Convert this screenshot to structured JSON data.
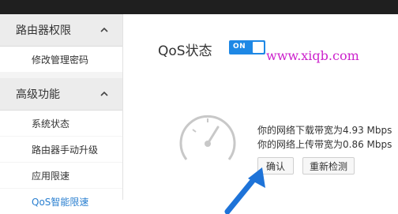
{
  "sidebar": {
    "groups": [
      {
        "label": "路由器权限",
        "expanded": true,
        "items": [
          "修改管理密码"
        ]
      },
      {
        "label": "高级功能",
        "expanded": true,
        "items": [
          "系统状态",
          "路由器手动升级",
          "应用限速",
          "QoS智能限速"
        ]
      }
    ]
  },
  "main": {
    "title": "QoS状态",
    "toggle_label": "ON",
    "watermark": "www.xiqb.com",
    "download_text": "你的网络下载带宽为4.93 Mbps",
    "upload_text": "你的网络上传带宽为0.86 Mbps",
    "confirm_label": "确认",
    "recheck_label": "重新检测"
  },
  "colors": {
    "accent": "#1e88e5",
    "watermark": "#cc22cc",
    "topbar": "#1f1f1f"
  },
  "icons": [
    "chevron-up-icon",
    "speedometer-icon",
    "pointer-arrow-icon"
  ]
}
